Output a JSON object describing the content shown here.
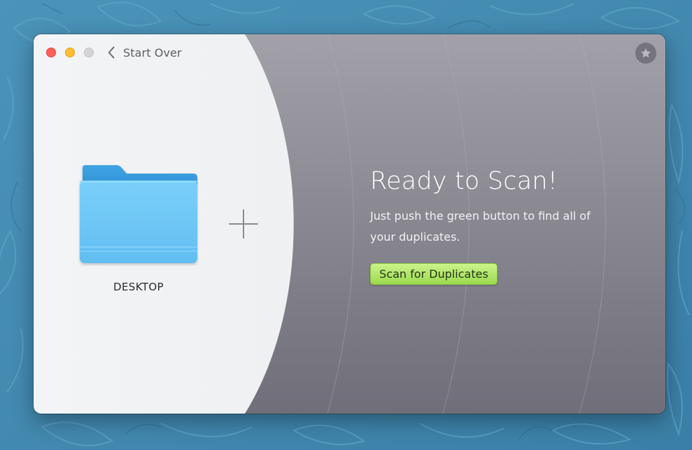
{
  "window": {
    "back_label": "Start Over",
    "star_icon": "star-icon"
  },
  "source": {
    "folder_label": "DESKTOP",
    "folder_color": "#6fc9f7",
    "add_icon": "plus-icon"
  },
  "main": {
    "headline": "Ready to Scan!",
    "subtext": "Just push the green button to find all of your duplicates.",
    "scan_button_label": "Scan for Duplicates",
    "scan_button_color": "#b5e86e"
  },
  "colors": {
    "panel_left": "#f3f4f6",
    "panel_right": "#8a8994",
    "wallpaper": "#3f86ad"
  }
}
